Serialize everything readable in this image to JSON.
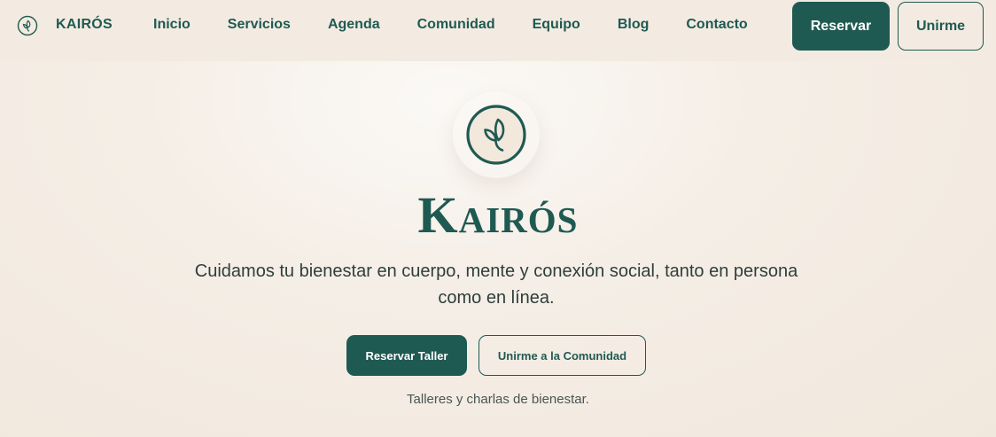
{
  "colors": {
    "accent": "#1f5a52",
    "background": "#f1e9df",
    "text": "#2f3e3b"
  },
  "navbar": {
    "logo_icon": "leaf-icon",
    "brand": "KAIRÓS",
    "links": [
      "Inicio",
      "Servicios",
      "Agenda",
      "Comunidad",
      "Equipo",
      "Blog",
      "Contacto"
    ],
    "reserve_label": "Reservar",
    "join_label": "Unirme"
  },
  "hero": {
    "logo_icon": "leaf-circle-icon",
    "title": "Kairós",
    "subtitle": "Cuidamos tu bienestar en cuerpo, mente y conexión social, tanto en persona como en línea.",
    "primary_label": "Reservar Taller",
    "secondary_label": "Unirme a la Comunidad",
    "caption": "Talleres y charlas de bienestar."
  }
}
